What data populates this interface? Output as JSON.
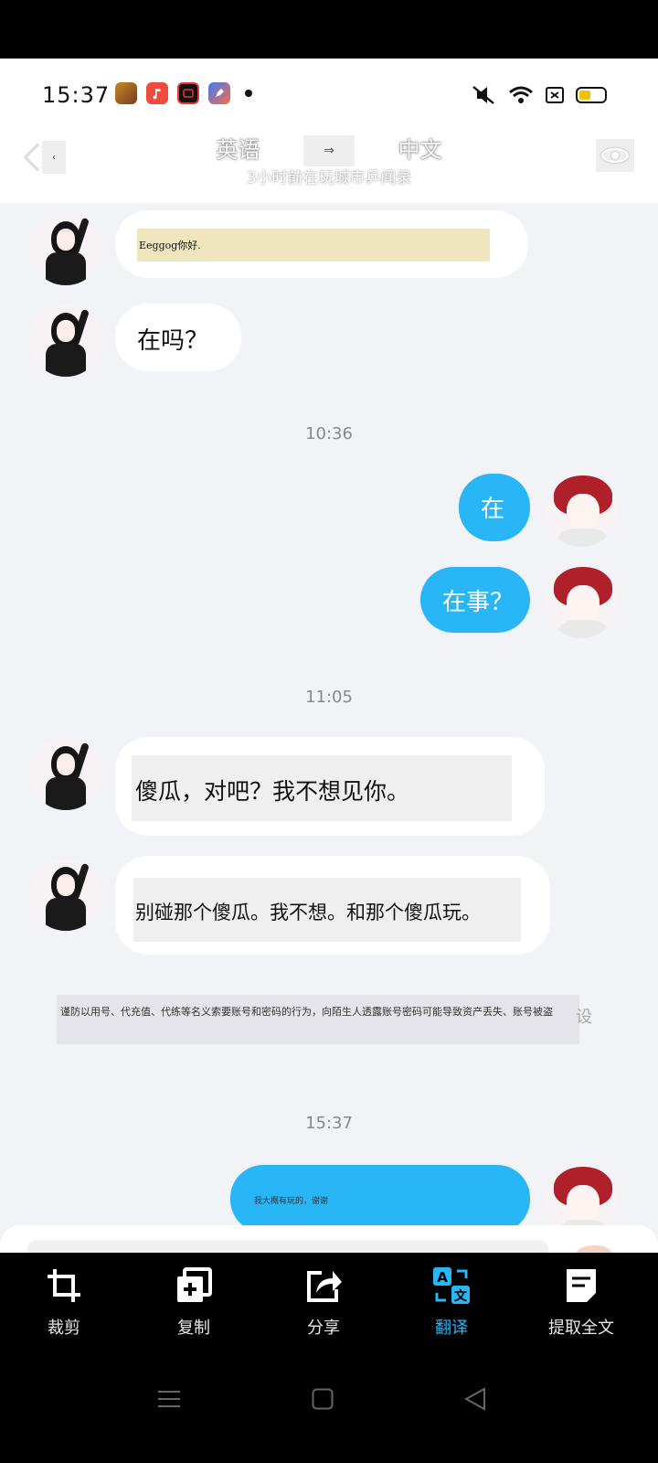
{
  "status": {
    "time": "15:37",
    "apps": [
      "game-app-icon",
      "music-app-icon",
      "recorder-app-icon",
      "pen-app-icon"
    ]
  },
  "header": {
    "back_label": "‹",
    "source_lang": "英语",
    "arrow": "⇒",
    "target_lang": "中文",
    "subtitle": "3小时前在玩城市乒闻录"
  },
  "messages": [
    {
      "side": "left",
      "text": "Eeggog你好."
    },
    {
      "side": "left",
      "text": "在吗？"
    },
    {
      "side": "timestamp",
      "text": "10:36"
    },
    {
      "side": "right",
      "text": "在"
    },
    {
      "side": "right",
      "text": "在事？"
    },
    {
      "side": "timestamp",
      "text": "11:05"
    },
    {
      "side": "left",
      "text": "傻瓜，对吧？我不想见你。"
    },
    {
      "side": "left",
      "text": "别碰那个傻瓜。我不想。和那个傻瓜玩。"
    },
    {
      "side": "timestamp",
      "text": "15:37"
    },
    {
      "side": "right",
      "text": "我大概有玩的，谢谢"
    }
  ],
  "notice": {
    "text": "谨防以用号、代充值、代练等名义索要账号和密码的行为，向陌生人透露账号密码可能导致资产丢失、账号被盗",
    "tail": "设"
  },
  "toolbar": {
    "items": [
      {
        "label": "裁剪",
        "icon": "crop-icon"
      },
      {
        "label": "复制",
        "icon": "copy-icon"
      },
      {
        "label": "分享",
        "icon": "share-icon"
      },
      {
        "label": "翻译",
        "icon": "translate-icon"
      },
      {
        "label": "提取全文",
        "icon": "extract-text-icon"
      }
    ],
    "active": "翻译",
    "active_color": "#29b6f6"
  },
  "colors": {
    "bubble_blue": "#29b6f6",
    "chat_bg": "#f1f3f7"
  }
}
